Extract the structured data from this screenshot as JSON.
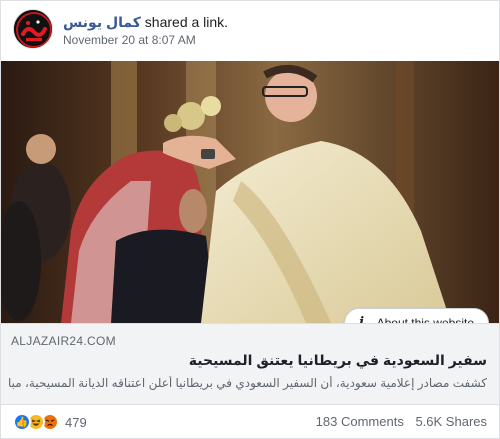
{
  "post": {
    "author": "كمال يونس",
    "action": "shared a link.",
    "timestamp": "November 20 at 8:07 AM",
    "avatar_text": "غزة",
    "avatar_subtext": "كل يوم"
  },
  "link": {
    "about_label": "About this website",
    "domain": "ALJAZAIR24.COM",
    "title": "سفير السعودية في بريطانيا يعتنق المسيحية",
    "description": "كشفت مصادر إعلامية سعودية، أن السفير السعودي في بريطانيا أعلن اعتناقه الديانة المسيحية، مباشرة بعد"
  },
  "reactions": {
    "types": [
      "like-icon",
      "haha-icon",
      "angry-icon"
    ],
    "count": "479"
  },
  "stats": {
    "comments": "183 Comments",
    "shares": "5.6K Shares"
  },
  "colors": {
    "link_blue": "#385898",
    "like": "#1877f2",
    "haha": "#f7b928",
    "angry": "#e9710f"
  }
}
